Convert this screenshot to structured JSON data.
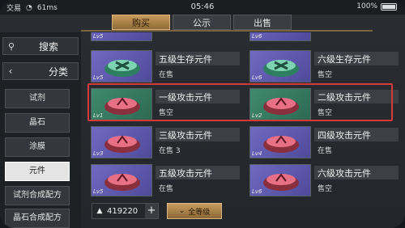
{
  "status": {
    "carrier": "交易",
    "signal": "61ms",
    "time": "05:46",
    "battery": "100%"
  },
  "tabs": [
    {
      "label": "购买",
      "active": true
    },
    {
      "label": "公示",
      "active": false
    },
    {
      "label": "出售",
      "active": false
    }
  ],
  "sidebar": {
    "search_label": "搜索",
    "category_label": "分类",
    "items": [
      {
        "label": "试剂",
        "active": false
      },
      {
        "label": "晶石",
        "active": false
      },
      {
        "label": "涂膜",
        "active": false
      },
      {
        "label": "元件",
        "active": true
      },
      {
        "label": "试剂合成配方",
        "active": false
      },
      {
        "label": "晶石合成配方",
        "active": false
      }
    ]
  },
  "grid": {
    "rows": [
      [
        {
          "name": "",
          "stock": "",
          "level": "Lv5",
          "color": "purple"
        },
        {
          "name": "",
          "stock": "",
          "level": "Lv6",
          "color": "purple"
        }
      ],
      [
        {
          "name": "五级生存元件",
          "stock": "在售",
          "level": "Lv5",
          "color": "purple"
        },
        {
          "name": "六级生存元件",
          "stock": "售空",
          "level": "Lv6",
          "color": "purple"
        }
      ],
      [
        {
          "name": "一级攻击元件",
          "stock": "售空",
          "level": "Lv1",
          "color": "green"
        },
        {
          "name": "二级攻击元件",
          "stock": "售空",
          "level": "Lv2",
          "color": "green"
        }
      ],
      [
        {
          "name": "三级攻击元件",
          "stock": "在售 3",
          "level": "Lv3",
          "color": "purple"
        },
        {
          "name": "四级攻击元件",
          "stock": "在售",
          "level": "Lv4",
          "color": "purple"
        }
      ],
      [
        {
          "name": "五级攻击元件",
          "stock": "在售",
          "level": "Lv5",
          "color": "purple"
        },
        {
          "name": "六级攻击元件",
          "stock": "售空",
          "level": "Lv6",
          "color": "purple"
        }
      ]
    ]
  },
  "wallet": {
    "icon": "currency-icon",
    "amount": "419220",
    "plus": "+"
  },
  "filter": {
    "label": "全等级",
    "icon": "chevron-down-icon"
  }
}
